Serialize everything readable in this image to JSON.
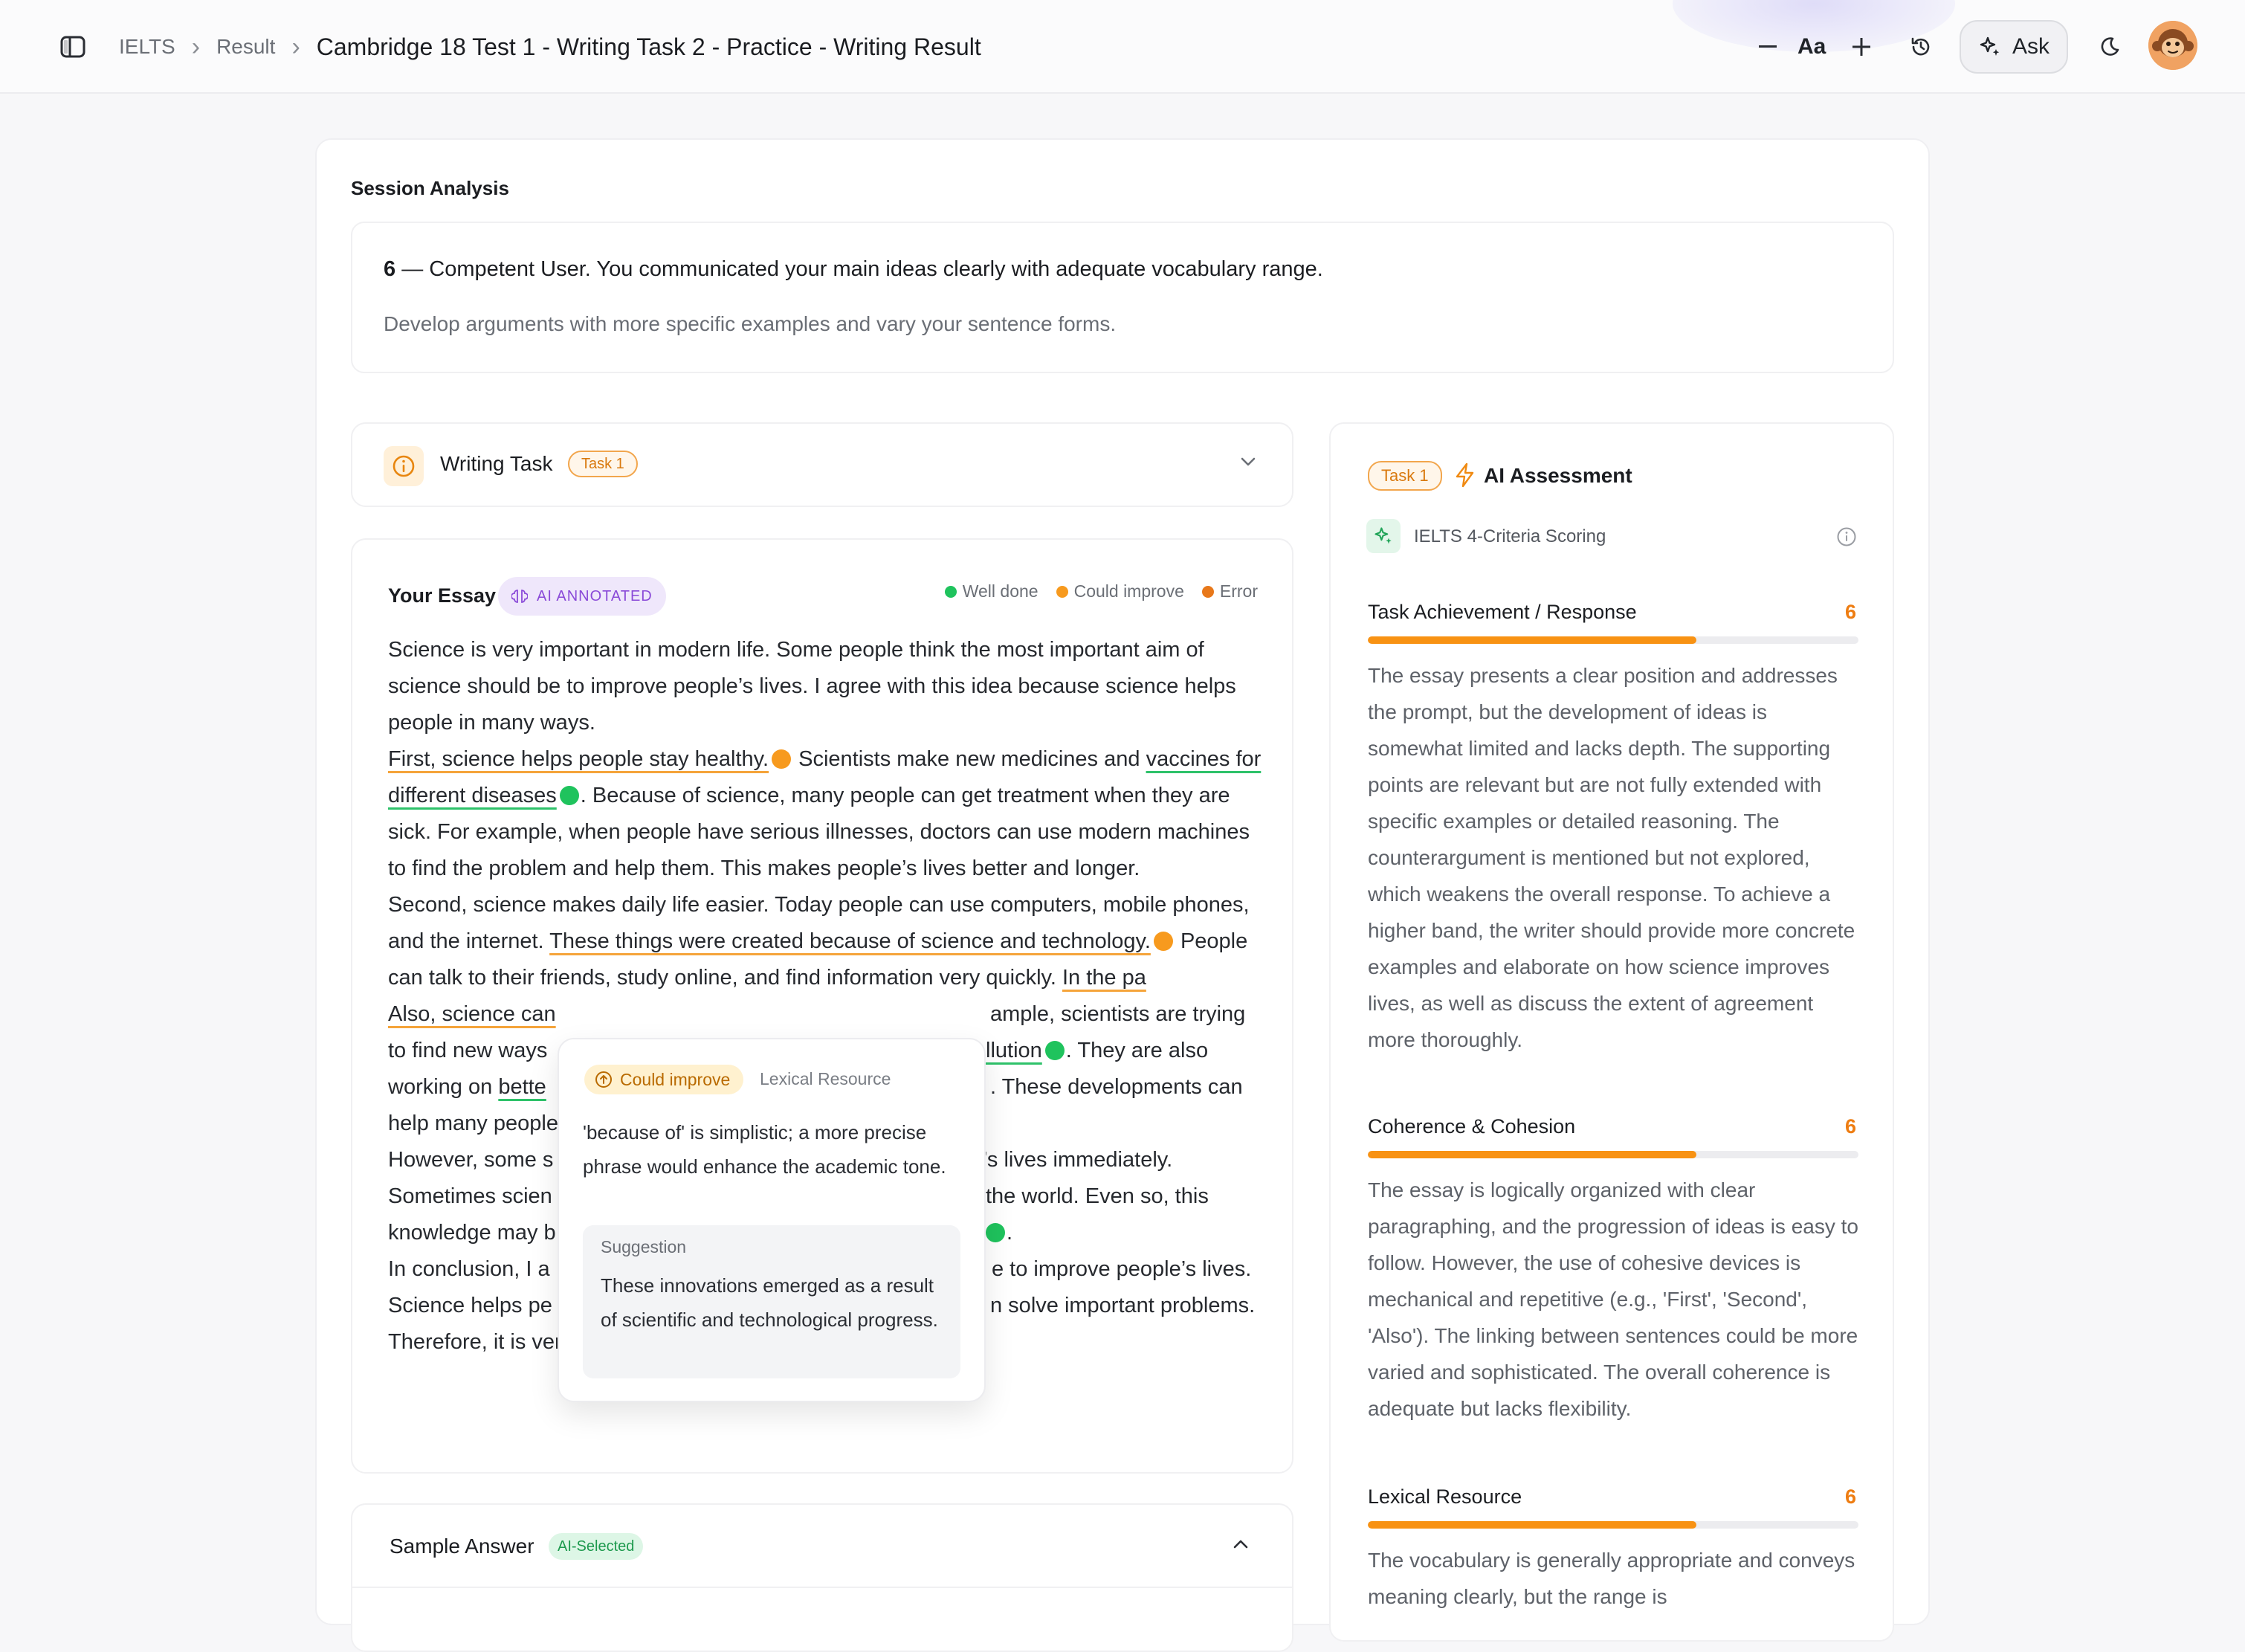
{
  "breadcrumb": {
    "items": [
      "IELTS",
      "Result"
    ],
    "current": "Cambridge 18 Test 1 - Writing Task 2 - Practice - Writing Result"
  },
  "toolbar": {
    "font_label": "Aa",
    "ask_label": "Ask",
    "icons": [
      "sidebar-toggle-icon",
      "minus-icon",
      "plus-icon",
      "history-icon",
      "sparkles-icon",
      "moon-icon"
    ]
  },
  "session": {
    "title": "Session Analysis",
    "band": "6",
    "summary": "— Competent User. You communicated your main ideas clearly with adequate vocabulary range.",
    "advice": "Develop arguments with more specific examples and vary your sentence forms."
  },
  "writing_task": {
    "label": "Writing Task",
    "badge": "Task 1"
  },
  "essay": {
    "title": "Your Essay",
    "badge": "AI ANNOTATED",
    "legend": {
      "well": "Well done",
      "improve": "Could improve",
      "error": "Error"
    },
    "colors": {
      "well": "#1fc35d",
      "improve": "#f79a1e",
      "error": "#e8781a"
    },
    "p1": "Science is very important in modern life. Some people think the most important aim of science should be to improve people’s lives. I agree with this idea because science helps people in many ways.",
    "p2_a": "First, science helps people stay healthy.",
    "p2_b": " Scientists make new medicines and ",
    "p2_c": "vaccines for different diseases",
    "p2_d": ". Because of science, many people can get treatment when they are sick. For example, when people have serious illnesses, doctors can use modern machines to find the problem and help them. This makes people’s lives better and longer.",
    "p3_a": "Second, science makes daily life easier. Today people can use computers, mobile phones, and the internet. ",
    "p3_b": "These things were created because of science and technology.",
    "p3_c": " People can talk to their friends, study online, and find information very quickly. ",
    "p3_d": "In the pa",
    "p4_a": "Also, science can",
    "p4_b": "ample, scientists are trying",
    "p4_c": "to find new ways",
    "p4_d": "llution",
    "p4_e": ". They are also",
    "p4_f": "working on ",
    "p4_g": "bette",
    "p4_h": ". These developments can",
    "p4_i": "help many people",
    "p5_a": "However, some s",
    "p5_b": "’s lives immediately.",
    "p5_c": "Sometimes scien",
    "p5_d": "the world. Even so, this",
    "p5_e": "knowledge may b",
    "p5_f": ".",
    "p6_a": "In conclusion, I a",
    "p6_b": "e to improve people’s lives.",
    "p6_c": "Science helps pe",
    "p6_d": "n solve important problems.",
    "p6_e": "Therefore, it is very important for the future of humanity."
  },
  "popup": {
    "status": "Could improve",
    "category": "Lexical Resource",
    "message": "'because of' is simplistic; a more precise phrase would enhance the academic tone.",
    "suggestion_label": "Suggestion",
    "suggestion": "These innovations emerged as a result of scientific and technological progress."
  },
  "sample": {
    "label": "Sample Answer",
    "badge": "AI-Selected"
  },
  "assessment": {
    "badge": "Task 1",
    "title": "AI Assessment",
    "scoring": "IELTS 4-Criteria Scoring",
    "criteria": [
      {
        "name": "Task Achievement / Response",
        "score": "6",
        "fraction": 0.67,
        "body": "The essay presents a clear position and addresses the prompt, but the development of ideas is somewhat limited and lacks depth. The supporting points are relevant but are not fully extended with specific examples or detailed reasoning. The counterargument is mentioned but not explored, which weakens the overall response. To achieve a higher band, the writer should provide more concrete examples and elaborate on how science improves lives, as well as discuss the extent of agreement more thoroughly."
      },
      {
        "name": "Coherence & Cohesion",
        "score": "6",
        "fraction": 0.67,
        "body": "The essay is logically organized with clear paragraphing, and the progression of ideas is easy to follow. However, the use of cohesive devices is mechanical and repetitive (e.g., 'First', 'Second', 'Also'). The linking between sentences could be more varied and sophisticated. The overall coherence is adequate but lacks flexibility."
      },
      {
        "name": "Lexical Resource",
        "score": "6",
        "fraction": 0.67,
        "body": "The vocabulary is generally appropriate and conveys meaning clearly, but the range is"
      }
    ]
  }
}
